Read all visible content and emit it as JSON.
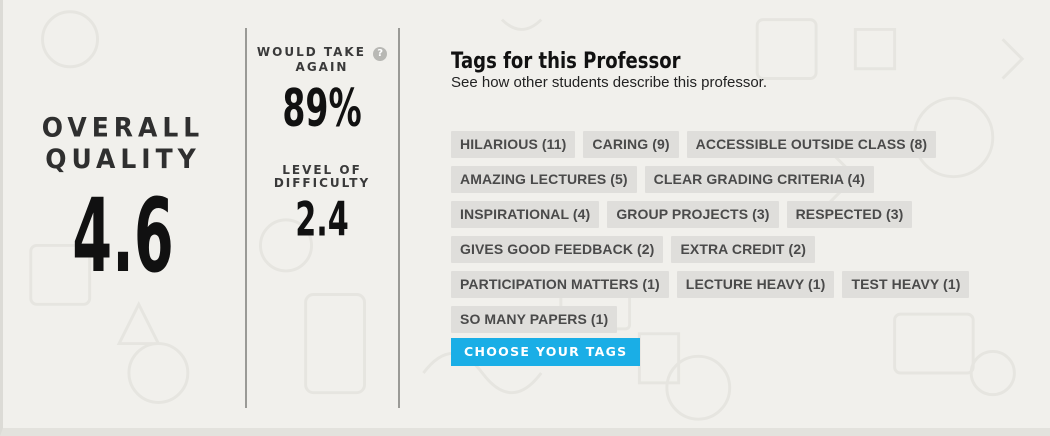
{
  "overall": {
    "label_line1": "OVERALL",
    "label_line2": "QUALITY",
    "score": "4.6"
  },
  "stats": {
    "would_take_again_line1": "WOULD TAKE",
    "would_take_again_line2": "AGAIN",
    "help_glyph": "?",
    "would_take_again_value": "89%",
    "difficulty_line1": "LEVEL OF",
    "difficulty_line2": "DIFFICULTY",
    "difficulty_value": "2.4"
  },
  "tags": {
    "title": "Tags for this Professor",
    "subtitle": "See how other students describe this professor.",
    "items": [
      "HILARIOUS (11)",
      "CARING (9)",
      "ACCESSIBLE OUTSIDE CLASS (8)",
      "AMAZING LECTURES (5)",
      "CLEAR GRADING CRITERIA (4)",
      "INSPIRATIONAL (4)",
      "GROUP PROJECTS (3)",
      "RESPECTED (3)",
      "GIVES GOOD FEEDBACK (2)",
      "EXTRA CREDIT (2)",
      "PARTICIPATION MATTERS (1)",
      "LECTURE HEAVY (1)",
      "TEST HEAVY (1)",
      "SO MANY PAPERS (1)"
    ],
    "choose_button": "CHOOSE YOUR TAGS"
  },
  "colors": {
    "accent": "#1aaee6",
    "tag_bg": "#dfdedb",
    "background": "#f1f0ec"
  }
}
